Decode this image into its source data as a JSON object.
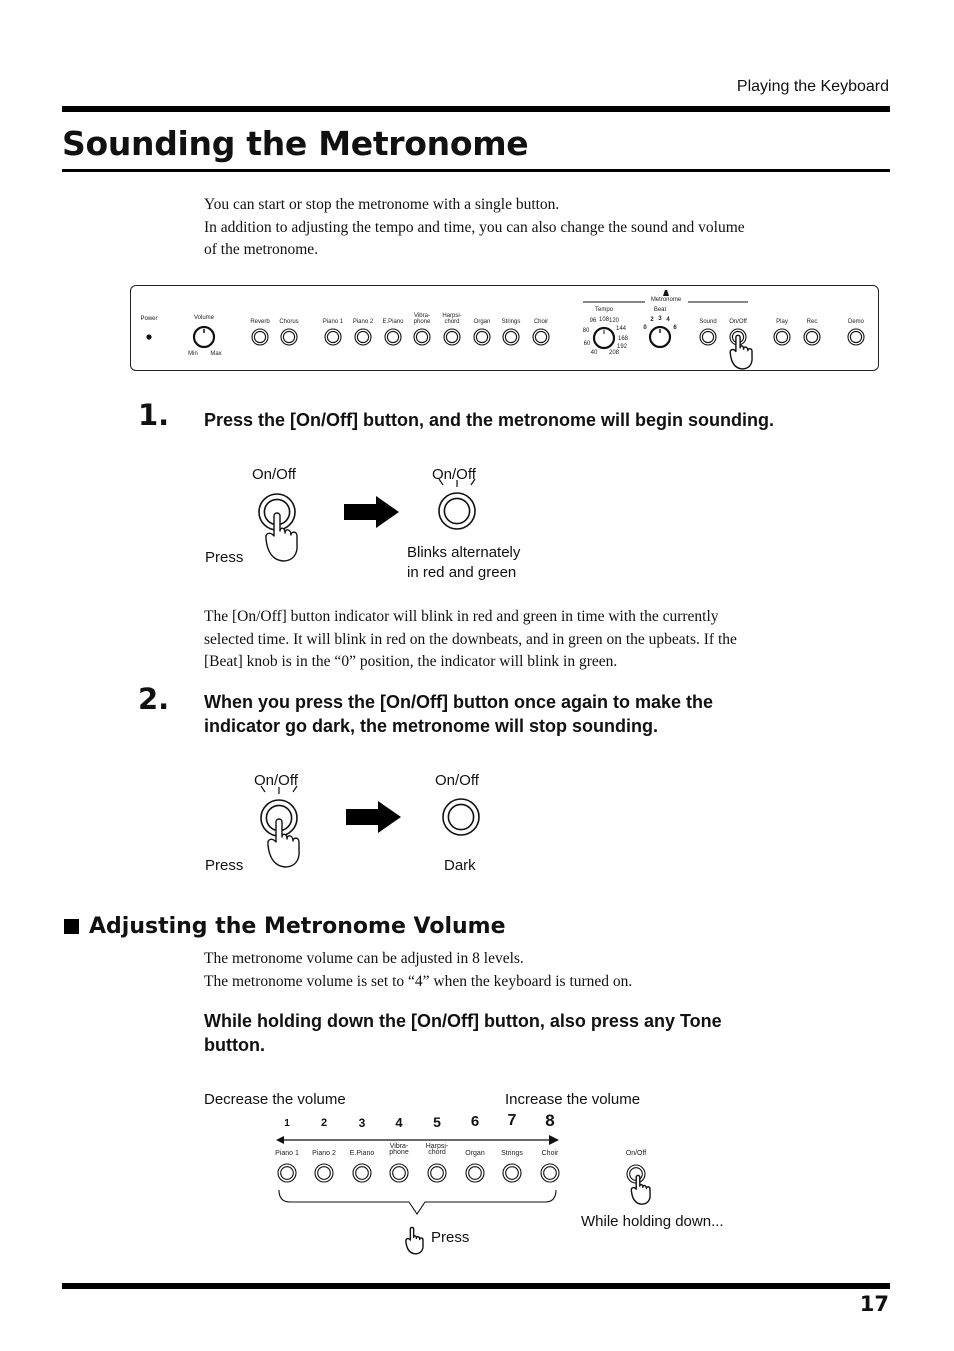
{
  "header": {
    "section": "Playing the Keyboard"
  },
  "title": "Sounding the Metronome",
  "intro": [
    "You can start or stop the metronome with a single button.",
    "In addition to adjusting the tempo and time, you can also change the sound and volume",
    "of the metronome."
  ],
  "panel": {
    "power": "Power",
    "volume": "Volume",
    "volume_min": "Min",
    "volume_max": "Max",
    "buttons": [
      "Reverb",
      "Chorus",
      "Piano 1",
      "Piano 2",
      "E.Piano",
      "Vibra-\nphone",
      "Harpsi-\nchord",
      "Organ",
      "Strings",
      "Choir",
      "Sound",
      "On/Off",
      "Play",
      "Rec",
      "Demo"
    ],
    "metronome_label": "Metronome",
    "tempo_label": "Tempo",
    "tempo_ticks": [
      "40",
      "60",
      "80",
      "96",
      "108",
      "120",
      "144",
      "168",
      "192",
      "208"
    ],
    "beat_label": "Beat",
    "beat_ticks": [
      "0",
      "2",
      "3",
      "4",
      "6"
    ]
  },
  "step1": {
    "number": "1.",
    "text": "Press the [On/Off] button, and the metronome will begin sounding.",
    "left_label": "On/Off",
    "right_label": "On/Off",
    "press": "Press",
    "result_line1": "Blinks alternately",
    "result_line2": "in red and green",
    "body": [
      "The [On/Off] button indicator will blink in red and green in time with the currently",
      "selected time. It will blink in red on the downbeats, and in green on the upbeats. If the",
      "[Beat] knob is in the “0” position, the indicator will blink in green."
    ]
  },
  "step2": {
    "number": "2.",
    "text_line1": "When you press the [On/Off] button once again to make the",
    "text_line2": "indicator go dark, the metronome will stop sounding.",
    "left_label": "On/Off",
    "right_label": "On/Off",
    "press": "Press",
    "result": "Dark"
  },
  "volume_section": {
    "heading": "Adjusting the Metronome Volume",
    "body": [
      "The metronome volume can be adjusted in 8 levels.",
      "The metronome volume is set to “4” when the keyboard is turned on."
    ],
    "instruction_line1": "While holding down the [On/Off] button, also press any Tone",
    "instruction_line2": "button.",
    "decrease": "Decrease the volume",
    "increase": "Increase the volume",
    "levels": [
      "1",
      "2",
      "3",
      "4",
      "5",
      "6",
      "7",
      "8"
    ],
    "tones": [
      "Piano 1",
      "Piano 2",
      "E.Piano",
      "Vibra-\nphone",
      "Harpsi-\nchord",
      "Organ",
      "Strings",
      "Choir"
    ],
    "onoff": "On/Off",
    "press": "Press",
    "holding": "While holding down..."
  },
  "footer": {
    "page_number": "17"
  }
}
